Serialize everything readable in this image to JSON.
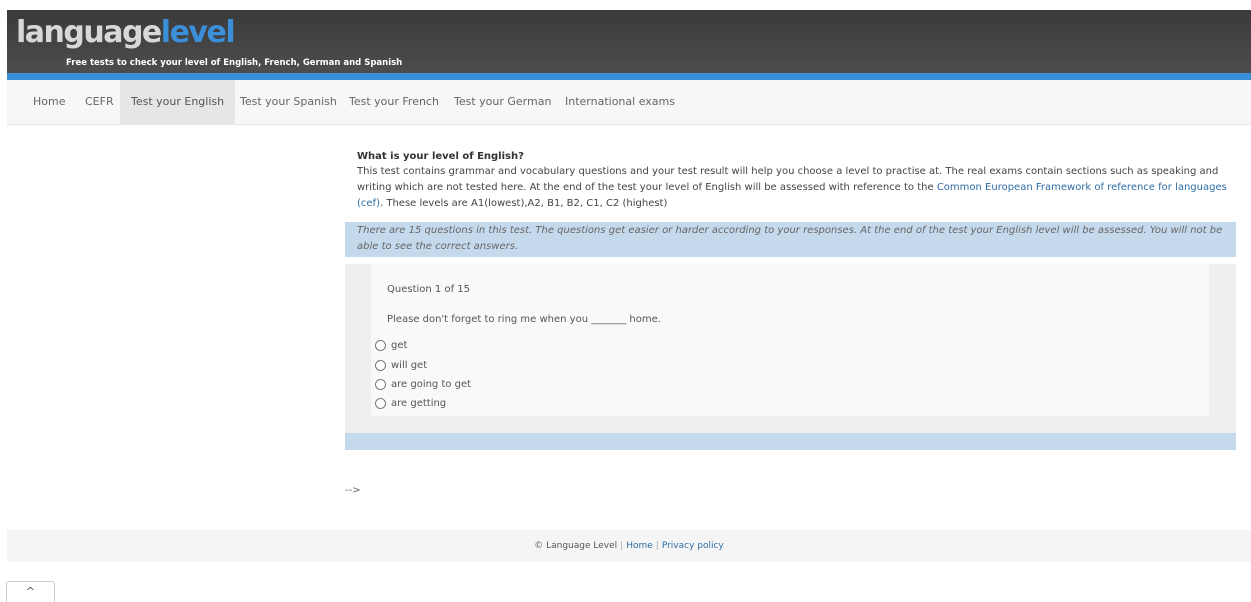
{
  "header": {
    "logo_part1": "language",
    "logo_part2": "level",
    "tagline": "Free tests to check your level of English, French, German and Spanish"
  },
  "nav": {
    "items": [
      {
        "label": "Home"
      },
      {
        "label": "CEFR"
      },
      {
        "label": "Test your English",
        "active": true
      },
      {
        "label": "Test your Spanish"
      },
      {
        "label": "Test your French"
      },
      {
        "label": "Test your German"
      },
      {
        "label": "International exams"
      }
    ]
  },
  "main": {
    "heading": "What is your level of English?",
    "intro_text": "This test contains grammar and vocabulary questions and your test result will help you choose a level to practise at. The real exams contain sections such as speaking and writing which are not tested here. At the end of the test your level of English will be assessed with reference to the",
    "intro_link": "Common European Framework of reference for languages (cef)",
    "intro_end": ". These levels are A1(lowest),A2, B1, B2, C1, C2 (highest)",
    "notice": "There are 15 questions in this test. The questions get easier or harder according to your responses. At the end of the test your English level will be assessed. You will not be able to see the correct answers.",
    "stray_text": "-->"
  },
  "quiz": {
    "counter": "Question 1 of 15",
    "question": "Please don't forget to ring me when you _______ home.",
    "options": [
      "get",
      "will get",
      "are going to get",
      "are getting"
    ]
  },
  "footer": {
    "copyright": "© Language Level",
    "home_link": "Home",
    "privacy_link": "Privacy policy",
    "separator": "|"
  },
  "scroll_top": {
    "icon": "chevron-up-icon",
    "glyph": "^"
  },
  "colors": {
    "accent_blue": "#3b8fd9",
    "header_dark": "#444444",
    "notice_bg": "#c5d9ec",
    "link": "#2e6da4"
  }
}
